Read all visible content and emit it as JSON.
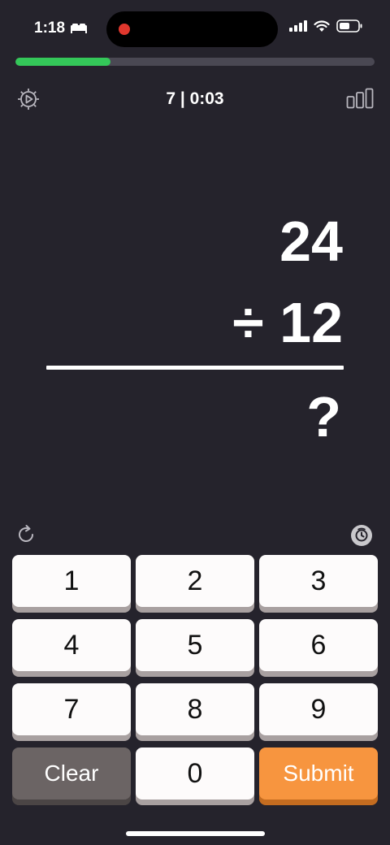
{
  "status_bar": {
    "time": "1:18",
    "icons": [
      "bed-icon",
      "recording-dot-icon",
      "cellular-signal-icon",
      "wifi-icon",
      "battery-icon"
    ]
  },
  "progress": {
    "fraction": 0.265,
    "color": "#34c759"
  },
  "toolbar": {
    "score_time": "7 | 0:03",
    "left_icon": "gear-play-icon",
    "right_icon": "bar-chart-icon"
  },
  "problem": {
    "operand1": "24",
    "operand2": "÷ 12",
    "answer": "?"
  },
  "controls": {
    "left_icon": "refresh-icon",
    "right_icon": "timer-icon"
  },
  "keypad": {
    "keys": [
      "1",
      "2",
      "3",
      "4",
      "5",
      "6",
      "7",
      "8",
      "9",
      "Clear",
      "0",
      "Submit"
    ]
  },
  "colors": {
    "background": "#25232c",
    "submit": "#f7953f",
    "clear": "#6b6464"
  }
}
